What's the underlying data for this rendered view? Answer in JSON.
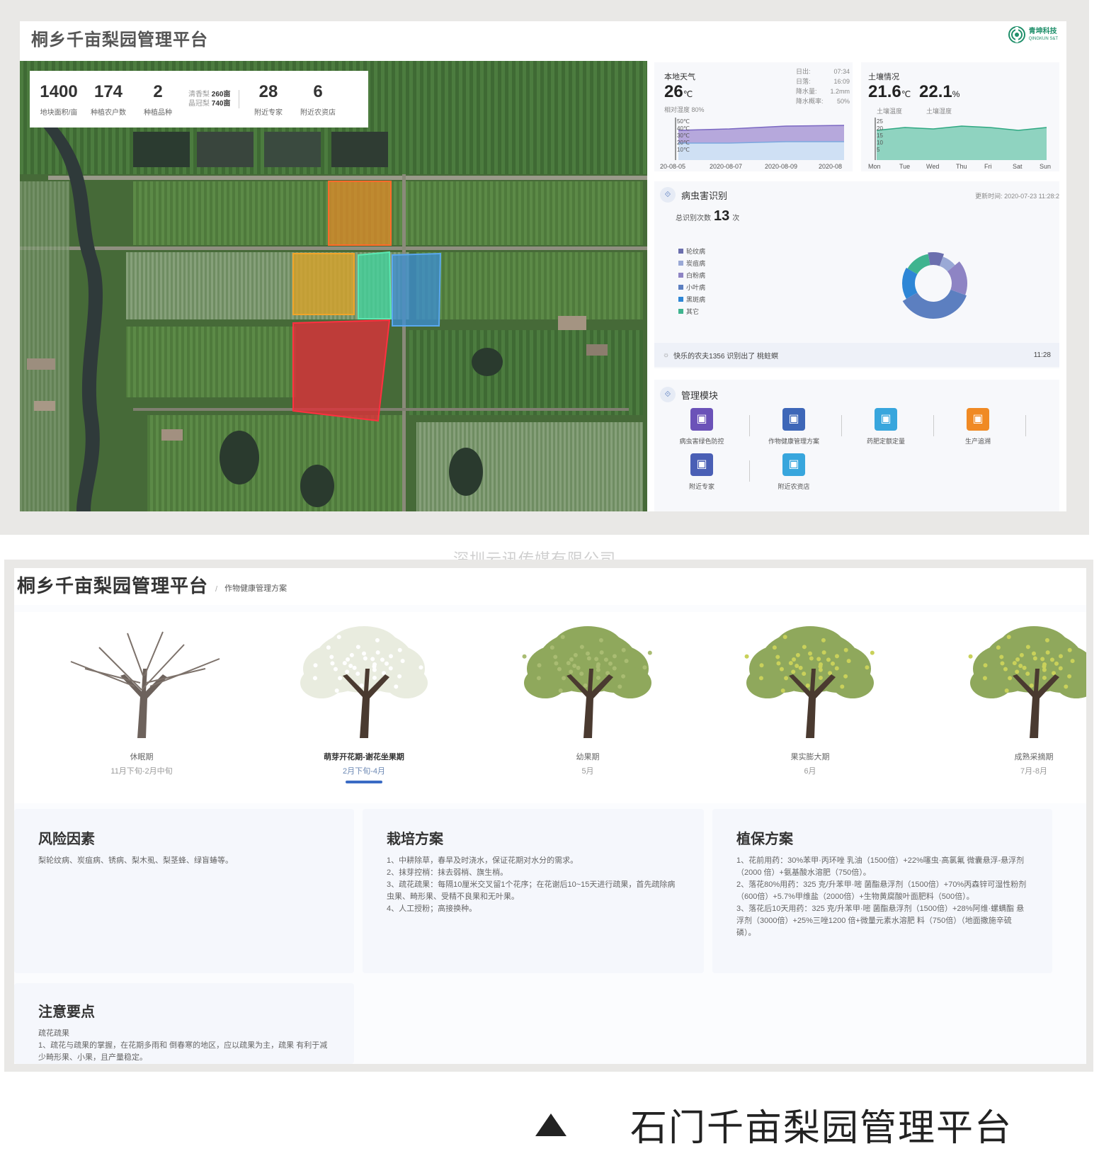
{
  "screen1": {
    "title": "桐乡千亩梨园管理平台",
    "logo": {
      "cn": "青坤科技",
      "en": "QINGKUN S&T"
    },
    "stats": [
      {
        "value": "1400",
        "label": "地块面积/亩"
      },
      {
        "value": "174",
        "label": "种植农户数"
      },
      {
        "value": "2",
        "label": "种植品种"
      }
    ],
    "varieties": [
      {
        "name": "清香梨",
        "value": "260亩"
      },
      {
        "name": "晶冠梨",
        "value": "740亩"
      }
    ],
    "stats2": [
      {
        "value": "28",
        "label": "附近专家"
      },
      {
        "value": "6",
        "label": "附近农资店"
      }
    ],
    "weather": {
      "title": "本地天气",
      "temp": "26",
      "unit": "℃",
      "humidity": "相对湿度 80%",
      "details": [
        {
          "k": "日出:",
          "v": "07:34"
        },
        {
          "k": "日落:",
          "v": "16:09"
        },
        {
          "k": "降水量:",
          "v": "1.2mm"
        },
        {
          "k": "降水概率:",
          "v": "50%"
        }
      ],
      "y_ticks": [
        "50℃",
        "40℃",
        "30℃",
        "20℃",
        "10℃"
      ],
      "x_ticks": [
        "20-08-05",
        "2020-08-07",
        "2020-08-09",
        "2020-08"
      ]
    },
    "soil": {
      "title": "土壤情况",
      "temp": "21.6",
      "temp_unit": "℃",
      "temp_label": "土壤温度",
      "humidity": "22.1",
      "humidity_unit": "%",
      "humidity_label": "土壤湿度",
      "y_ticks": [
        "25",
        "20",
        "15",
        "10",
        "5"
      ],
      "x_ticks": [
        "Mon",
        "Tue",
        "Wed",
        "Thu",
        "Fri",
        "Sat",
        "Sun"
      ]
    },
    "pest": {
      "title": "病虫害识别",
      "updated": "更新时间: 2020-07-23 11:28:2",
      "total_label": "总识别次数",
      "total": "13",
      "total_unit": "次",
      "legend": [
        {
          "name": "轮纹病",
          "color": "#6b6fae"
        },
        {
          "name": "炭疽病",
          "color": "#9aa9d6"
        },
        {
          "name": "白粉病",
          "color": "#8e84c4"
        },
        {
          "name": "小叶病",
          "color": "#5c7fc0"
        },
        {
          "name": "黑斑病",
          "color": "#2e86d6"
        },
        {
          "name": "其它",
          "color": "#3fb48f"
        }
      ],
      "notice": "快乐的农夫1356 识别出了 桃蛀螟",
      "notice_time": "11:28"
    },
    "modules": {
      "title": "管理模块",
      "items": [
        {
          "label": "病虫害绿色防控",
          "color": "#6b52b8",
          "icon": "shield-star-icon"
        },
        {
          "label": "作物健康管理方案",
          "color": "#3e67b8",
          "icon": "health-plan-icon"
        },
        {
          "label": "药肥定额定量",
          "color": "#38a6dd",
          "icon": "database-icon"
        },
        {
          "label": "生产追溯",
          "color": "#f08a24",
          "icon": "trace-icon"
        },
        {
          "label": "附近专家",
          "color": "#4a5fb5",
          "icon": "expert-icon"
        },
        {
          "label": "附近农资店",
          "color": "#38a6dd",
          "icon": "shop-icon"
        }
      ]
    }
  },
  "watermark": "深圳云讯传媒有限公司",
  "screen2": {
    "title": "桐乡千亩梨园管理平台",
    "sep": "/",
    "breadcrumb": "作物健康管理方案",
    "stages": [
      {
        "name": "休眠期",
        "date": "11月下旬-2月中旬"
      },
      {
        "name": "萌芽开花期-谢花坐果期",
        "date": "2月下旬-4月"
      },
      {
        "name": "幼果期",
        "date": "5月"
      },
      {
        "name": "果实膨大期",
        "date": "6月"
      },
      {
        "name": "成熟采摘期",
        "date": "7月-8月"
      }
    ],
    "cards": {
      "risk": {
        "title": "风险因素",
        "body": "梨轮纹病、炭疽病、锈病、梨木虱、梨茎蜂、绿盲蝽等。"
      },
      "cultivation": {
        "title": "栽培方案",
        "body": "1、中耕除草，春旱及时浇水，保证花期对水分的需求。\n2、抹芽控梢：抹去弱梢、旗生梢。\n3、疏花疏果：每隔10厘米交叉留1个花序；在花谢后10~15天进行疏果，首先疏除病虫果、畸形果、受精不良果和无叶果。\n4、人工授粉；高接换种。"
      },
      "protection": {
        "title": "植保方案",
        "body": "1、花前用药：30%苯甲·丙环唑 乳油（1500倍）+22%噻虫·高氯氟 微囊悬浮-悬浮剂（2000 倍）+氨基酸水溶肥（750倍）。\n2、落花80%用药：325 克/升苯甲·嘧 菌酯悬浮剂（1500倍）+70%丙森锌可湿性粉剂（600倍）+5.7%甲维盐（2000倍）+生物黄腐酸叶面肥料（500倍）。\n3、落花后10天用药：325 克/升苯甲·嘧 菌酯悬浮剂（1500倍）+28%阿维·螺螨酯 悬浮剂（3000倍）+25%三唑1200 倍+微量元素水溶肥 料（750倍）（地面撒施辛硫磷）。"
      },
      "notes": {
        "title": "注意要点",
        "body": "疏花疏果\n1、疏花与疏果的掌握，在花期多雨和 倒春寒的地区，应以疏果为主，疏果 有利于减少畸形果、小果，且产量稳定。"
      }
    }
  },
  "caption": "石门千亩梨园管理平台"
}
